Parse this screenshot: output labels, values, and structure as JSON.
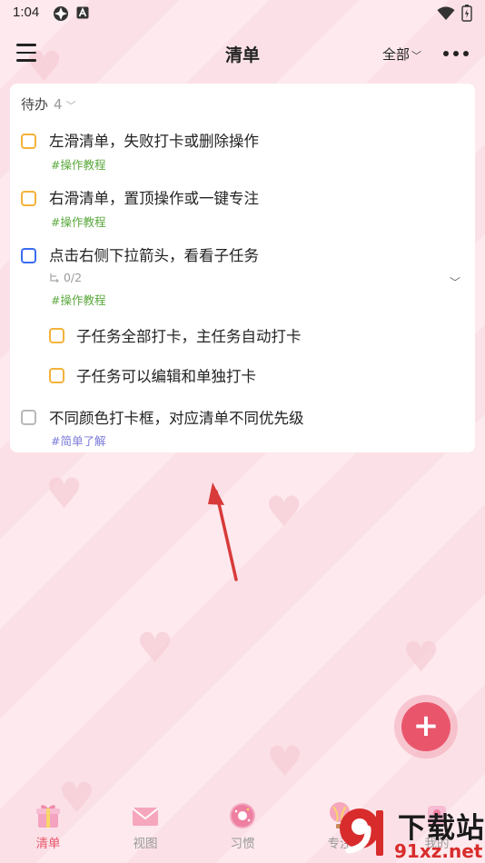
{
  "status_bar": {
    "time": "1:04"
  },
  "header": {
    "title": "清单",
    "filter_label": "全部"
  },
  "section": {
    "label": "待办",
    "count": "4"
  },
  "tasks": [
    {
      "title": "左滑清单，失败打卡或删除操作",
      "tag": "#操作教程"
    },
    {
      "title": "右滑清单，置顶操作或一键专注",
      "tag": "#操作教程"
    },
    {
      "title": "点击右侧下拉箭头，看看子任务",
      "subtasks_count": "0/2",
      "tag": "#操作教程",
      "subtasks": [
        {
          "title": "子任务全部打卡，主任务自动打卡"
        },
        {
          "title": "子任务可以编辑和单独打卡"
        }
      ]
    },
    {
      "title": "不同颜色打卡框，对应清单不同优先级",
      "tag": "#简单了解"
    }
  ],
  "fab": {
    "symbol": "+"
  },
  "bottom_nav": [
    {
      "label": "清单",
      "icon": "gift-box-icon",
      "active": true
    },
    {
      "label": "视图",
      "icon": "envelope-icon"
    },
    {
      "label": "习惯",
      "icon": "donut-icon"
    },
    {
      "label": "专注",
      "icon": "hot-air-balloon-icon"
    },
    {
      "label": "我的",
      "icon": "profile-icon"
    }
  ],
  "watermark": {
    "text": "下载站",
    "url": "91xz.net"
  },
  "colors": {
    "accent": "#e9566c",
    "checkbox_orange": "#f5b23a",
    "checkbox_blue": "#3a6cf0",
    "checkbox_gray": "#b8b8b8",
    "tag_green": "#5aa83c",
    "tag_purple": "#7a79d8",
    "annotation_arrow": "#d83a3a"
  }
}
